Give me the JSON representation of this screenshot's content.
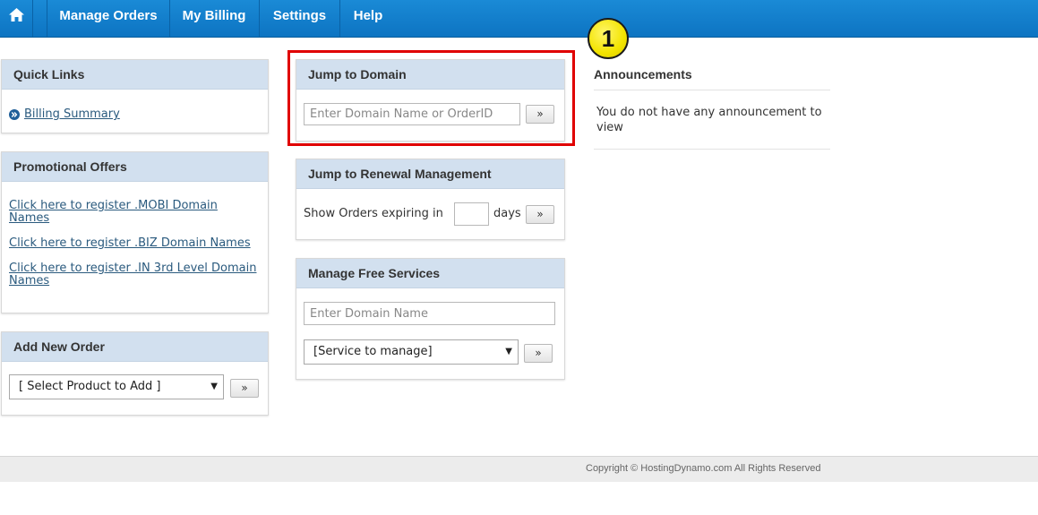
{
  "nav": {
    "home_icon": "home-icon",
    "items": [
      "Manage Orders",
      "My Billing",
      "Settings",
      "Help"
    ]
  },
  "quick_links": {
    "title": "Quick Links",
    "items": [
      "Billing Summary"
    ]
  },
  "promotional_offers": {
    "title": "Promotional Offers",
    "items": [
      "Click here to register .MOBI Domain Names",
      "Click here to register .BIZ Domain Names",
      "Click here to register .IN 3rd Level Domain Names"
    ]
  },
  "add_new_order": {
    "title": "Add New Order",
    "select_value": "[ Select Product to Add ]",
    "go_label": "»"
  },
  "jump_to_domain": {
    "title": "Jump to Domain",
    "placeholder": "Enter Domain Name or OrderID",
    "go_label": "»"
  },
  "renewal": {
    "title": "Jump to Renewal Management",
    "prefix": "Show Orders expiring in",
    "suffix": "days",
    "go_label": "»"
  },
  "free_services": {
    "title": "Manage Free Services",
    "placeholder": "Enter Domain Name",
    "select_value": "[Service to manage]",
    "go_label": "»"
  },
  "announcements": {
    "title": "Announcements",
    "text": "You do not have any announcement to view"
  },
  "annotation": {
    "badge": "1",
    "color": "#e00000"
  },
  "footer": {
    "copyright": "Copyright © HostingDynamo.com All Rights Reserved"
  }
}
